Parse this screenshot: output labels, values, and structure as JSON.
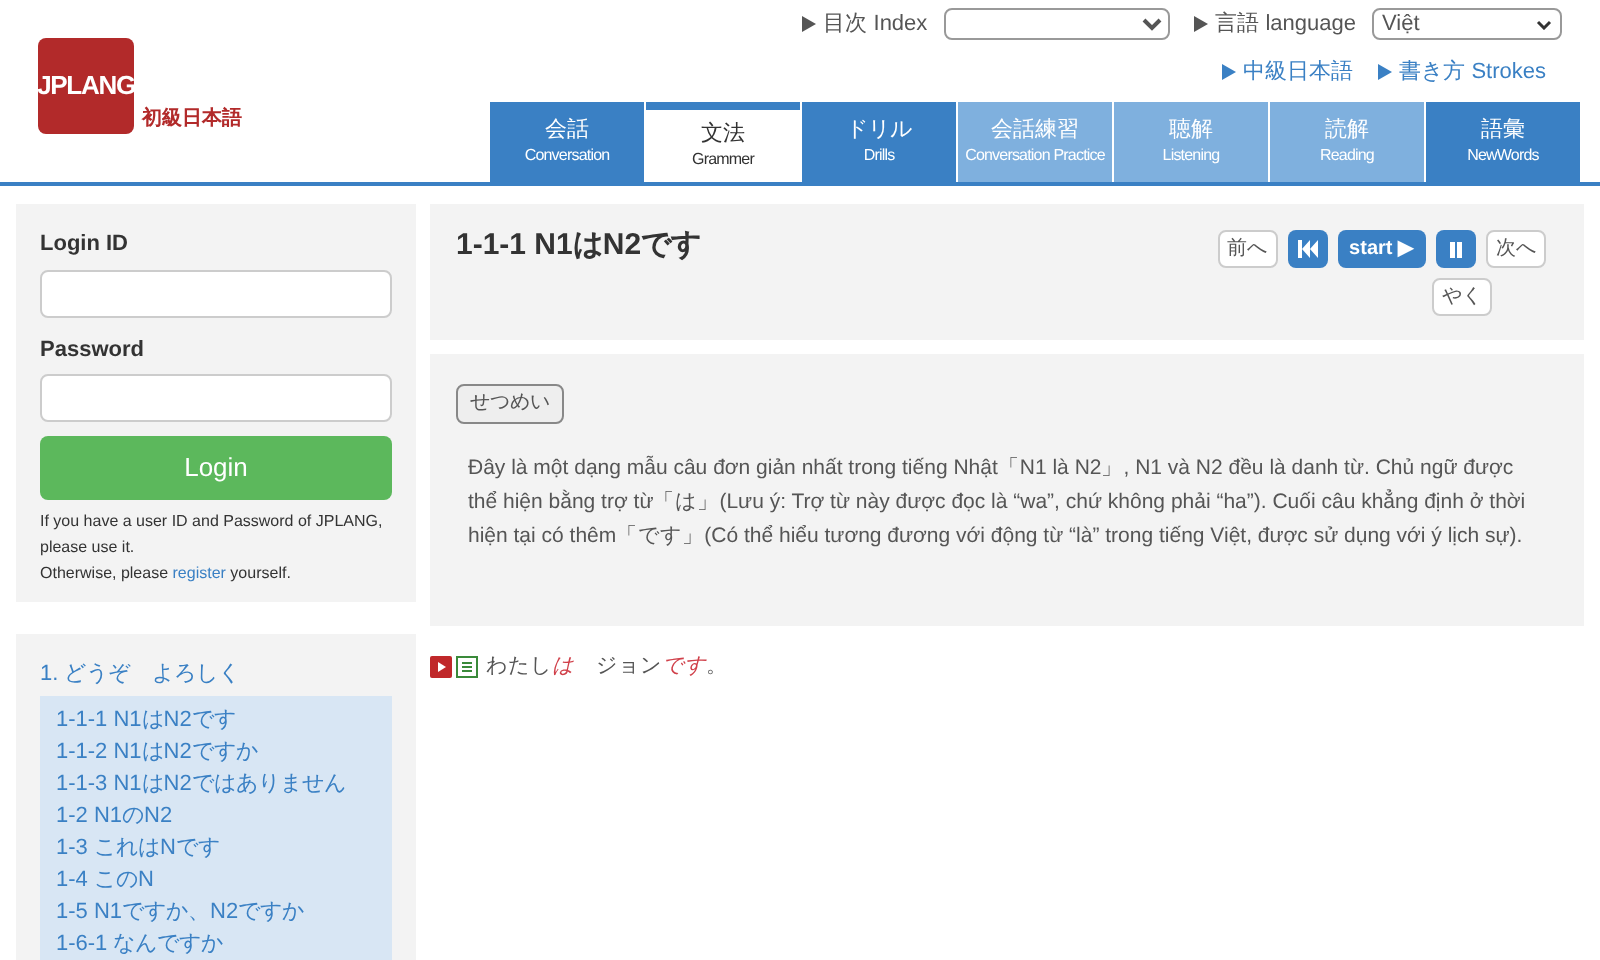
{
  "logo": {
    "mark": "JPLANG",
    "subtitle": "初級日本語"
  },
  "top_links": {
    "index_label": "目次 Index",
    "language_label": "言語 language",
    "language_value": "Việt",
    "links": [
      "中級日本語",
      "書き方 Strokes"
    ]
  },
  "tabs": [
    {
      "jp": "会話",
      "en": "Conversation",
      "selected": false,
      "disabled": false
    },
    {
      "jp": "文法",
      "en": "Grammer",
      "selected": true,
      "disabled": false
    },
    {
      "jp": "ドリル",
      "en": "Drills",
      "selected": false,
      "disabled": false
    },
    {
      "jp": "会話練習",
      "en": "Conversation Practice",
      "selected": false,
      "disabled": true
    },
    {
      "jp": "聴解",
      "en": "Listening",
      "selected": false,
      "disabled": true
    },
    {
      "jp": "読解",
      "en": "Reading",
      "selected": false,
      "disabled": true
    },
    {
      "jp": "語彙",
      "en": "NewWords",
      "selected": false,
      "disabled": false
    }
  ],
  "login": {
    "id_label": "Login ID",
    "password_label": "Password",
    "button": "Login",
    "note_1": "If you have a user ID and Password of JPLANG, please use it.",
    "note_2_before": "Otherwise, please ",
    "note_2_link": "register",
    "note_2_after": " yourself."
  },
  "index": {
    "heading": "1. どうぞ　よろしく",
    "items": [
      "1-1-1 N1はN2です",
      "1-1-2 N1はN2ですか",
      "1-1-3 N1はN2ではありません",
      "1-2 N1のN2",
      "1-3 これはNです",
      "1-4 このN",
      "1-5 N1ですか、N2ですか",
      "1-6-1 なんですか"
    ]
  },
  "lesson": {
    "title": "1-1-1 N1はN2です",
    "controls": [
      {
        "kind": "text",
        "label": "前へ"
      },
      {
        "kind": "rewind"
      },
      {
        "kind": "start",
        "label": "start ▶"
      },
      {
        "kind": "pause"
      },
      {
        "kind": "text",
        "label": "次へ"
      }
    ],
    "translate_button": "やく"
  },
  "explanation": {
    "button": "せつめい",
    "text": "Đây là một dạng mẫu câu đơn giản nhất trong tiếng Nhật「N1 là N2」, N1 và N2 đều là danh từ. Chủ ngữ được thể hiện bằng trợ từ「は」(Lưu ý: Trợ từ này được đọc là “wa”, chứ không phải “ha”). Cuối câu khẳng định ở thời hiện tại có thêm「です」(Có thể hiểu tương đương với động từ “là” trong tiếng Việt, được sử dụng với ý lịch sự)."
  },
  "sentence": [
    {
      "text": "わたし",
      "highlight": false
    },
    {
      "text": "は",
      "highlight": true
    },
    {
      "text": "　ジョン",
      "highlight": false
    },
    {
      "text": "です",
      "highlight": true
    },
    {
      "text": "。",
      "highlight": false
    }
  ]
}
